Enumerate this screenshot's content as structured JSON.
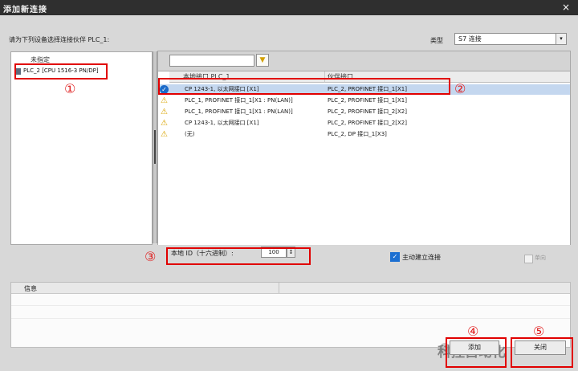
{
  "window": {
    "title": "添加新连接",
    "close_glyph": "×"
  },
  "dialog": {
    "prompt": "请为下列设备选择连接伙伴 PLC_1:",
    "type_label": "类型",
    "type_value": "S7 连接",
    "dropdown_glyph": "▾"
  },
  "tree": {
    "header": "未指定",
    "item_label": "PLC_2 [CPU 1516-3 PN/DP]"
  },
  "grid": {
    "filter_value": "",
    "filter_glyph": "▼",
    "columns": [
      "本地接口 PLC_1",
      "伙伴接口"
    ],
    "rows": [
      {
        "status": "ok",
        "icon": "check-icon",
        "glyph": "✓",
        "local": "CP 1243-1, 以太网接口 [X1]",
        "partner": "PLC_2, PROFINET 接口_1[X1]"
      },
      {
        "status": "warning",
        "icon": "warning-icon",
        "glyph": "⚠",
        "local": "PLC_1, PROFINET 接口_1[X1 : PN(LAN)]",
        "partner": "PLC_2, PROFINET 接口_1[X1]"
      },
      {
        "status": "warning",
        "icon": "warning-icon",
        "glyph": "⚠",
        "local": "PLC_1, PROFINET 接口_1[X1 : PN(LAN)]",
        "partner": "PLC_2, PROFINET 接口_2[X2]"
      },
      {
        "status": "warning",
        "icon": "warning-icon",
        "glyph": "⚠",
        "local": "CP 1243-1, 以太网接口 [X1]",
        "partner": "PLC_2, PROFINET 接口_2[X2]"
      },
      {
        "status": "warning",
        "icon": "warning-icon",
        "glyph": "⚠",
        "local": "(无)",
        "partner": "PLC_2, DP 接口_1[X3]"
      }
    ]
  },
  "local_id": {
    "label": "本地 ID（十六进制）:",
    "value": "100",
    "spin_glyph": "↕"
  },
  "options": {
    "active_label": "主动建立连接",
    "active_checked": true,
    "active_glyph": "✓",
    "single_label": "单向",
    "single_checked": false
  },
  "info": {
    "header": "信息"
  },
  "buttons": {
    "add": "添加",
    "close": "关闭"
  },
  "annotations": [
    "①",
    "②",
    "③",
    "④",
    "⑤"
  ],
  "watermark": "科控自动化",
  "colors": {
    "highlight": "#e10000",
    "selected_row": "#c4d7ef",
    "check_blue": "#1c6fd1",
    "warning": "#d9a400"
  }
}
